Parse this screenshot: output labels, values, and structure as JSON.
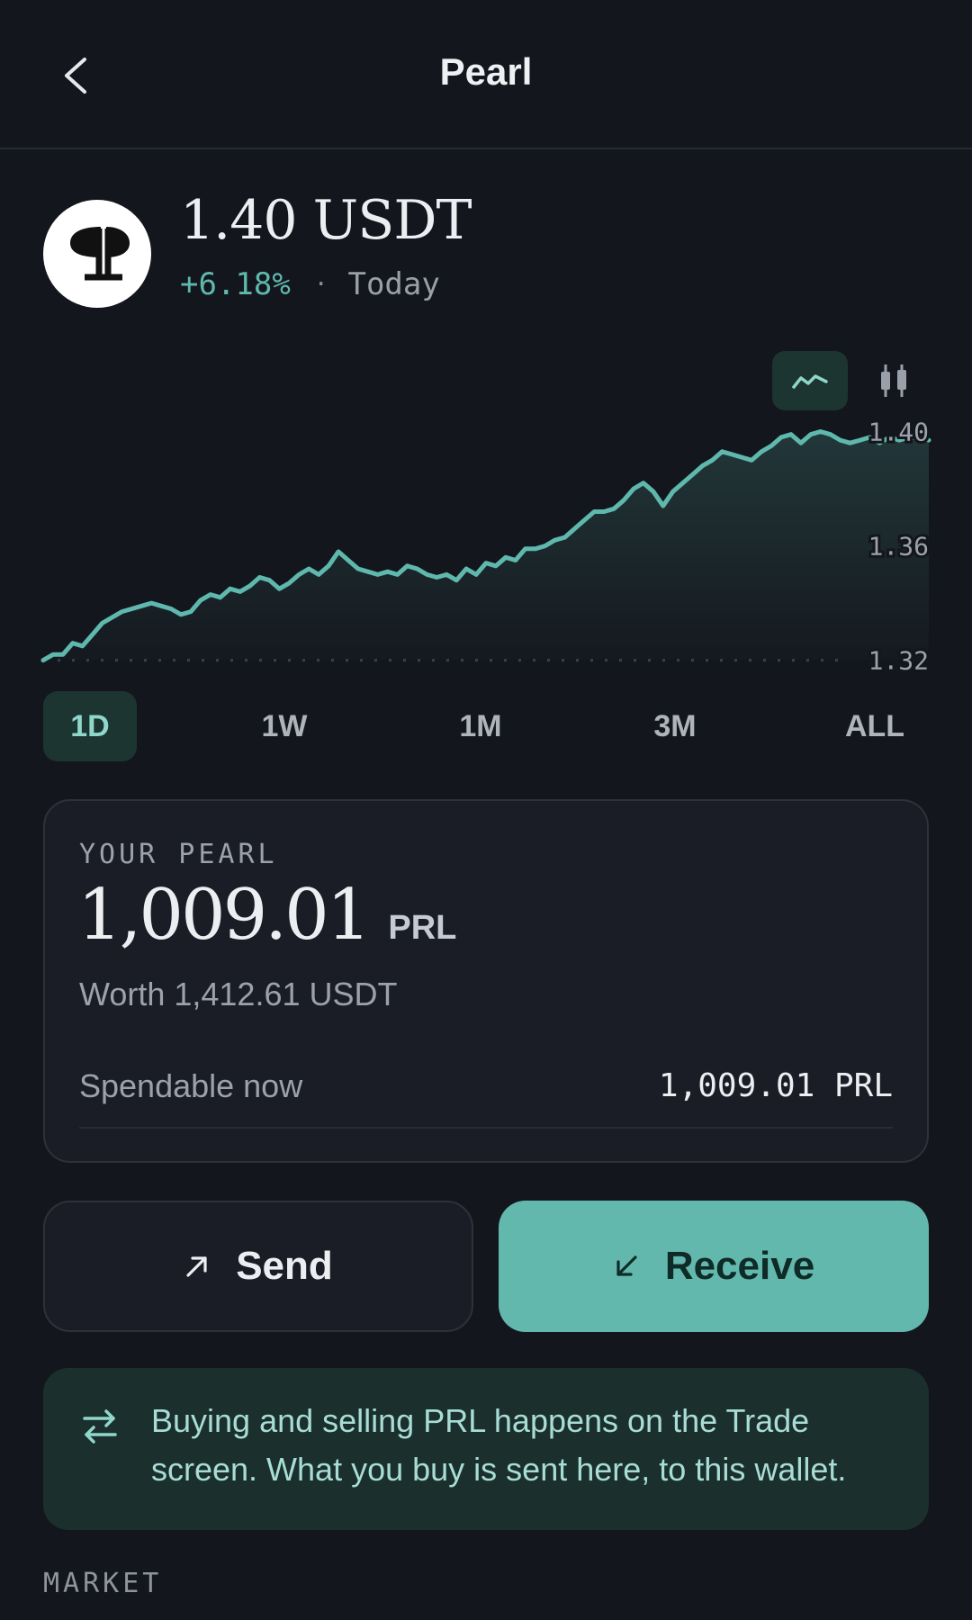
{
  "header": {
    "title": "Pearl",
    "back_icon": "chevron-left-icon"
  },
  "coin": {
    "logo_icon": "pearl-logo-icon",
    "price": "1.40 USDT",
    "change_percent": "+6.18%",
    "change_separator": "·",
    "change_period": "Today"
  },
  "chart_controls": {
    "line_icon": "line-chart-icon",
    "candle_icon": "candlestick-icon",
    "active": "line"
  },
  "chart_data": {
    "type": "area",
    "y_ticks": [
      "1.40",
      "1.36",
      "1.32"
    ],
    "ylim": [
      1.318,
      1.403
    ],
    "baseline": 1.32,
    "line_color": "#5fb8ad",
    "values": [
      1.32,
      1.322,
      1.322,
      1.326,
      1.325,
      1.329,
      1.333,
      1.335,
      1.337,
      1.338,
      1.339,
      1.34,
      1.339,
      1.338,
      1.336,
      1.337,
      1.341,
      1.343,
      1.342,
      1.345,
      1.344,
      1.346,
      1.349,
      1.348,
      1.345,
      1.347,
      1.35,
      1.352,
      1.35,
      1.353,
      1.358,
      1.355,
      1.352,
      1.351,
      1.35,
      1.351,
      1.35,
      1.353,
      1.352,
      1.35,
      1.349,
      1.35,
      1.348,
      1.352,
      1.35,
      1.354,
      1.353,
      1.356,
      1.355,
      1.359,
      1.359,
      1.36,
      1.362,
      1.363,
      1.366,
      1.369,
      1.372,
      1.372,
      1.373,
      1.376,
      1.38,
      1.382,
      1.379,
      1.374,
      1.379,
      1.382,
      1.385,
      1.388,
      1.39,
      1.393,
      1.392,
      1.391,
      1.39,
      1.393,
      1.395,
      1.398,
      1.399,
      1.396,
      1.399,
      1.4,
      1.399,
      1.397,
      1.396,
      1.397,
      1.398,
      1.396,
      1.398,
      1.397,
      1.398,
      1.398,
      1.397
    ]
  },
  "ranges": {
    "items": [
      "1D",
      "1W",
      "1M",
      "3M",
      "ALL"
    ],
    "active": "1D"
  },
  "holdings": {
    "label": "YOUR PEARL",
    "amount": "1,009.01",
    "unit": "PRL",
    "worth": "Worth 1,412.61 USDT",
    "spendable_label": "Spendable now",
    "spendable_value": "1,009.01 PRL"
  },
  "actions": {
    "send_label": "Send",
    "send_icon": "arrow-up-right-icon",
    "receive_label": "Receive",
    "receive_icon": "arrow-down-left-icon"
  },
  "info": {
    "icon": "swap-arrows-icon",
    "text": "Buying and selling PRL happens on the Trade screen. What you buy is sent here, to this wallet."
  },
  "market": {
    "label": "MARKET"
  }
}
